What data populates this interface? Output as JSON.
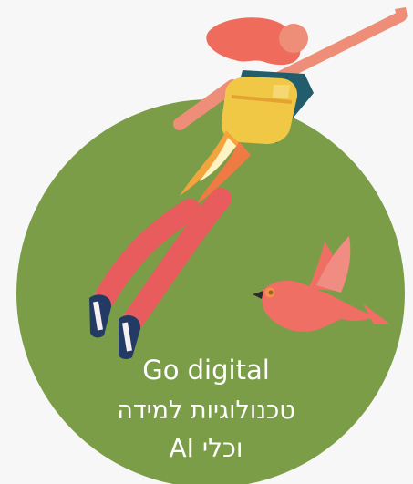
{
  "card": {
    "line1": "Go digital",
    "line2": "טכנולוגיות למידה",
    "line3": "וכלי AI"
  },
  "colors": {
    "background": "#f7f7f7",
    "circle": "#7c9d47",
    "text": "#ffffff"
  },
  "icons": {
    "character": "flying-woman-jetpack-illustration",
    "bird": "red-bird-illustration"
  }
}
